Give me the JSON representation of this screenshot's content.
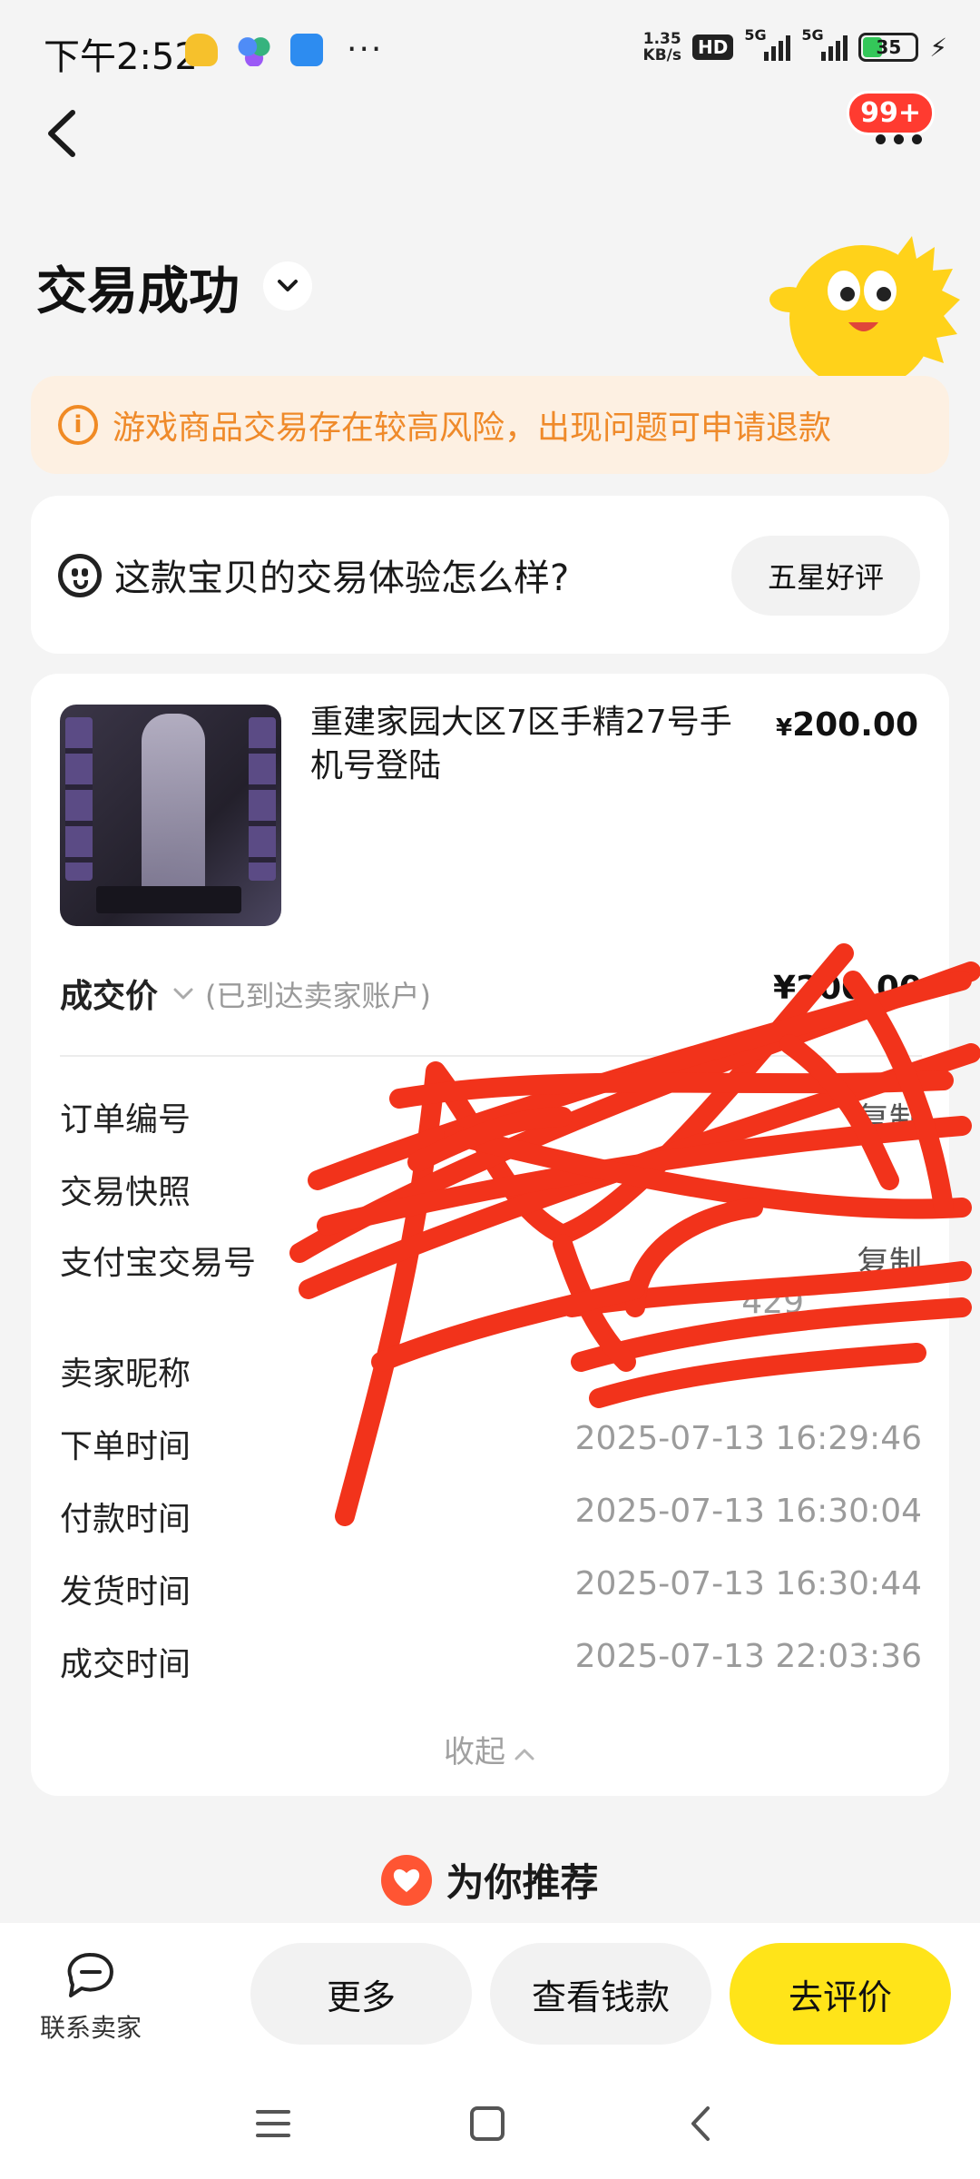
{
  "status_bar": {
    "time": "下午2:52",
    "more": "···",
    "speed_value": "1.35",
    "speed_unit": "KB/s",
    "hd": "HD",
    "net1": "5G",
    "net2": "5G",
    "battery": "35"
  },
  "header": {
    "badge": "99+",
    "title": "交易成功"
  },
  "warning": {
    "icon": "i",
    "text": "游戏商品交易存在较高风险，出现问题可申请退款"
  },
  "rating": {
    "question": "这款宝贝的交易体验怎么样?",
    "button": "五星好评"
  },
  "product": {
    "title": "重建家园大区7区手精27号手机号登陆",
    "currency": "¥",
    "price": "200.00"
  },
  "deal": {
    "label": "成交价",
    "note": "(已到达卖家账户)",
    "price": "¥200.00"
  },
  "details": [
    {
      "label": "订单编号",
      "value": "",
      "action": "复制"
    },
    {
      "label": "交易快照",
      "value": ""
    },
    {
      "label": "支付宝交易号",
      "value": "429",
      "action": "复制"
    },
    {
      "label": "卖家昵称",
      "value": ""
    },
    {
      "label": "下单时间",
      "value": "2025-07-13 16:29:46"
    },
    {
      "label": "付款时间",
      "value": "2025-07-13 16:30:04"
    },
    {
      "label": "发货时间",
      "value": "2025-07-13 16:30:44"
    },
    {
      "label": "成交时间",
      "value": "2025-07-13 22:03:36"
    }
  ],
  "collapse_label": "收起",
  "recommend": "为你推荐",
  "bottom_bar": {
    "contact": "联系卖家",
    "more": "更多",
    "view_money": "查看钱款",
    "review": "去评价"
  },
  "colors": {
    "accent_yellow": "#ffe419",
    "warning_orange": "#ef8a2a",
    "badge_red": "#ff3b30",
    "scribble_red": "#f2331b"
  }
}
